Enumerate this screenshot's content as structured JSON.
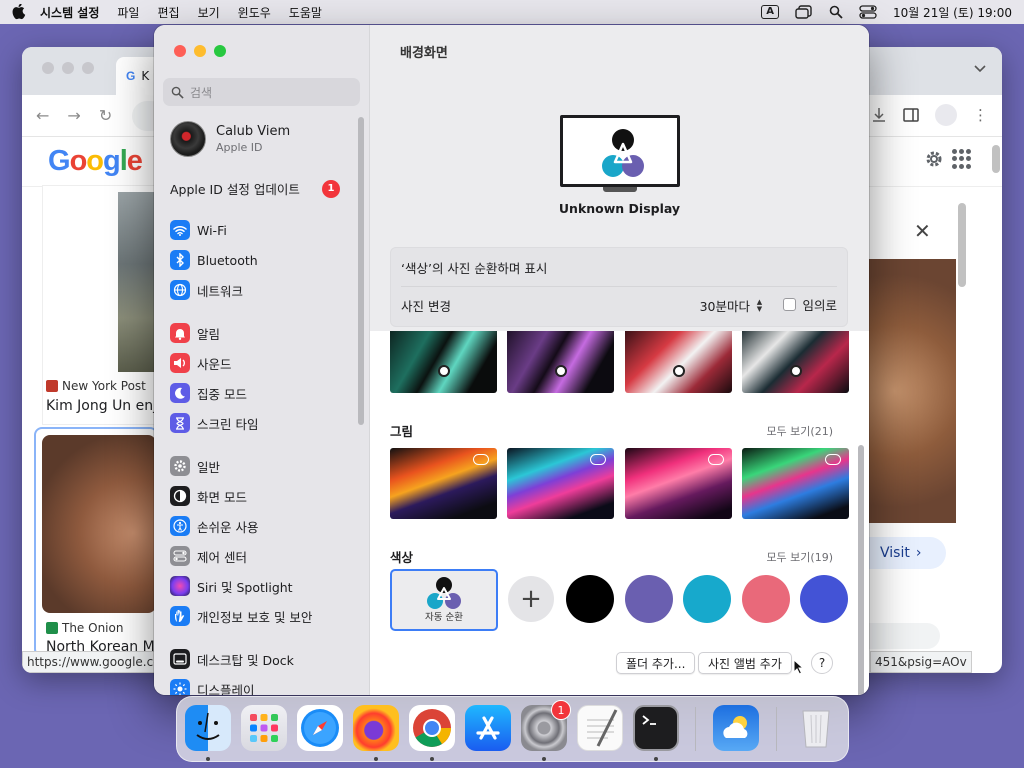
{
  "menubar": {
    "app_name": "시스템 설정",
    "menus": [
      "파일",
      "편집",
      "보기",
      "윈도우",
      "도움말"
    ],
    "input_source": "A",
    "clock": "10월 21일 (토) 19:00"
  },
  "chrome": {
    "tab_initial": "K",
    "logo": "Google",
    "status_url": "https://www.google.co",
    "status_url_right": "451&psig=AOv",
    "cards": [
      {
        "source": "New York Post",
        "headline": "Kim Jong Un enjo"
      },
      {
        "source": "The Onion",
        "headline": "North Korean Me"
      }
    ],
    "visit_label": "Visit",
    "visit_chevron": "›",
    "close_glyph": "✕"
  },
  "settings": {
    "search_placeholder": "검색",
    "account": {
      "name": "Calub Viem",
      "sub": "Apple ID"
    },
    "update": {
      "label": "Apple ID 설정 업데이트",
      "badge": "1"
    },
    "nav": [
      {
        "label": "Wi-Fi",
        "icon": "wifi-icon",
        "color": "#1a7cf5"
      },
      {
        "label": "Bluetooth",
        "icon": "bluetooth-icon",
        "color": "#1a7cf5"
      },
      {
        "label": "네트워크",
        "icon": "globe-icon",
        "color": "#1a7cf5"
      },
      {
        "label": "알림",
        "icon": "bell-icon",
        "color": "#f0414a"
      },
      {
        "label": "사운드",
        "icon": "speaker-icon",
        "color": "#f0414a"
      },
      {
        "label": "집중 모드",
        "icon": "moon-icon",
        "color": "#5e5ce6"
      },
      {
        "label": "스크린 타임",
        "icon": "hourglass-icon",
        "color": "#5e5ce6"
      },
      {
        "label": "일반",
        "icon": "gear-icon",
        "color": "#8e8e93"
      },
      {
        "label": "화면 모드",
        "icon": "appearance-icon",
        "color": "#1d1d1f"
      },
      {
        "label": "손쉬운 사용",
        "icon": "accessibility-icon",
        "color": "#1a7cf5"
      },
      {
        "label": "제어 센터",
        "icon": "control-center-icon",
        "color": "#8e8e93"
      },
      {
        "label": "Siri 및 Spotlight",
        "icon": "siri-icon",
        "color": "#b43cd8"
      },
      {
        "label": "개인정보 보호 및 보안",
        "icon": "hand-icon",
        "color": "#1a7cf5"
      },
      {
        "label": "데스크탑 및 Dock",
        "icon": "dock-icon",
        "color": "#1d1d1f"
      },
      {
        "label": "디스플레이",
        "icon": "display-icon",
        "color": "#1a7cf5"
      }
    ],
    "page_title": "배경화면",
    "display_name": "Unknown Display",
    "shuffle_text": "‘색상’의 사진 순환하며 표시",
    "change_photo_label": "사진 변경",
    "interval": "30분마다",
    "random_label": "임의로",
    "sections": [
      {
        "title": "그림",
        "see_all": "모두 보기(21)"
      },
      {
        "title": "색상",
        "see_all": "모두 보기(19)"
      }
    ],
    "auto_tile_label": "자동 순환",
    "add_glyph": "+",
    "swatches": [
      "#000000",
      "#6a5fb0",
      "#17a9cc",
      "#e9697a",
      "#4353d6"
    ],
    "buttons": {
      "add_folder": "폴더 추가...",
      "add_album": "사진 앨범 추가",
      "help": "?"
    }
  },
  "dock": {
    "items": [
      "Finder",
      "Launchpad",
      "Safari",
      "Firefox",
      "Chrome",
      "App Store",
      "시스템 설정",
      "TextEdit",
      "Terminal",
      "날씨",
      "휴지통"
    ],
    "settings_badge": "1"
  }
}
